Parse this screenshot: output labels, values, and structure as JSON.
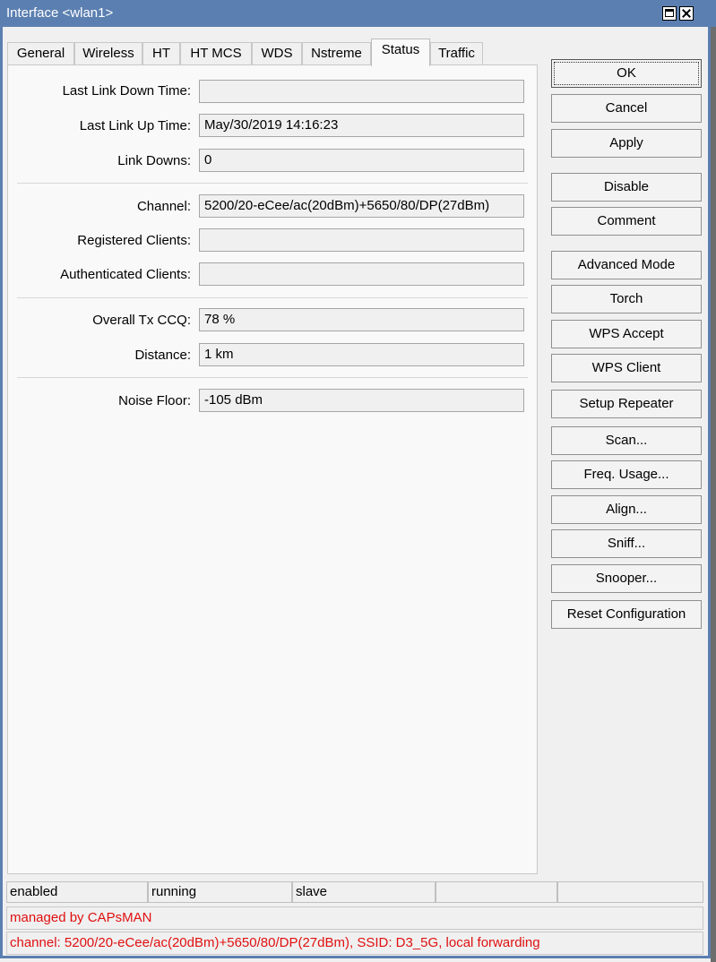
{
  "window": {
    "title": "Interface <wlan1>"
  },
  "tabs": [
    {
      "label": "General"
    },
    {
      "label": "Wireless"
    },
    {
      "label": "HT"
    },
    {
      "label": "HT MCS"
    },
    {
      "label": "WDS"
    },
    {
      "label": "Nstreme"
    },
    {
      "label": "Status"
    },
    {
      "label": "Traffic"
    }
  ],
  "active_tab": "Status",
  "fields": {
    "last_link_down_time": {
      "label": "Last Link Down Time:",
      "value": ""
    },
    "last_link_up_time": {
      "label": "Last Link Up Time:",
      "value": "May/30/2019 14:16:23"
    },
    "link_downs": {
      "label": "Link Downs:",
      "value": "0"
    },
    "channel": {
      "label": "Channel:",
      "value": "5200/20-eCee/ac(20dBm)+5650/80/DP(27dBm)"
    },
    "registered_clients": {
      "label": "Registered Clients:",
      "value": ""
    },
    "authenticated_clients": {
      "label": "Authenticated Clients:",
      "value": ""
    },
    "overall_tx_ccq": {
      "label": "Overall Tx CCQ:",
      "value": "78 %"
    },
    "distance": {
      "label": "Distance:",
      "value": "1 km"
    },
    "noise_floor": {
      "label": "Noise Floor:",
      "value": "-105 dBm"
    }
  },
  "buttons": {
    "ok": "OK",
    "cancel": "Cancel",
    "apply": "Apply",
    "disable": "Disable",
    "comment": "Comment",
    "advanced_mode": "Advanced Mode",
    "torch": "Torch",
    "wps_accept": "WPS Accept",
    "wps_client": "WPS Client",
    "setup_repeater": "Setup Repeater",
    "scan": "Scan...",
    "freq_usage": "Freq. Usage...",
    "align": "Align...",
    "sniff": "Sniff...",
    "snooper": "Snooper...",
    "reset_configuration": "Reset Configuration"
  },
  "status_bar": {
    "cells": [
      "enabled",
      "running",
      "slave",
      "",
      ""
    ],
    "managed_message": "managed by CAPsMAN",
    "channel_message": "channel: 5200/20-eCee/ac(20dBm)+5650/80/DP(27dBm), SSID: D3_5G, local forwarding"
  },
  "colors": {
    "titlebar": "#5b7fb0",
    "status_message": "#e01010"
  }
}
